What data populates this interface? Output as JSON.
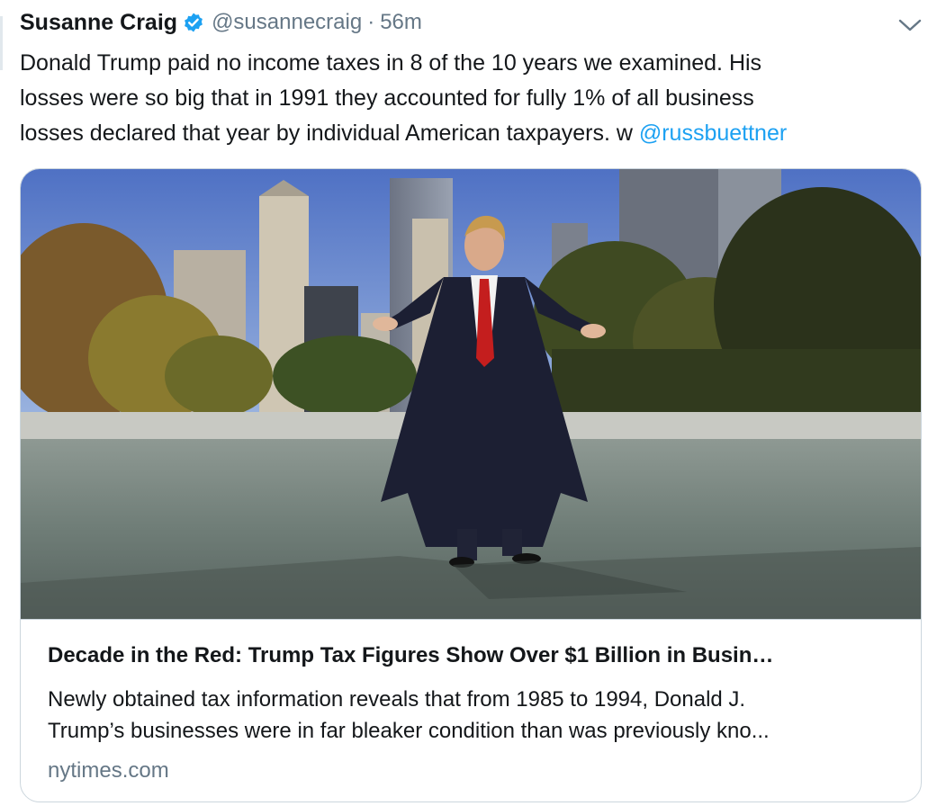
{
  "tweet": {
    "display_name": "Susanne Craig",
    "handle": "@susannecraig",
    "separator": "·",
    "time": "56m",
    "text_lines": [
      "Donald Trump paid no income taxes in 8 of the 10 years we examined. His",
      "losses were so big that in 1991 they accounted for fully 1% of all business",
      "losses declared that year by individual American taxpayers. w "
    ],
    "mention": "@russbuettner",
    "icons": {
      "verified": "verified-badge-icon",
      "caret": "chevron-down-icon"
    },
    "colors": {
      "accent": "#1da1f2",
      "secondary_text": "#657786",
      "border": "#ccd6dd"
    }
  },
  "card": {
    "title": "Decade in the Red: Trump Tax Figures Show Over $1 Billion in Busin…",
    "description_lines": [
      "Newly obtained tax information reveals that from 1985 to 1994, Donald J.",
      "Trump’s businesses were in far bleaker condition than was previously kno..."
    ],
    "domain": "nytimes.com"
  }
}
